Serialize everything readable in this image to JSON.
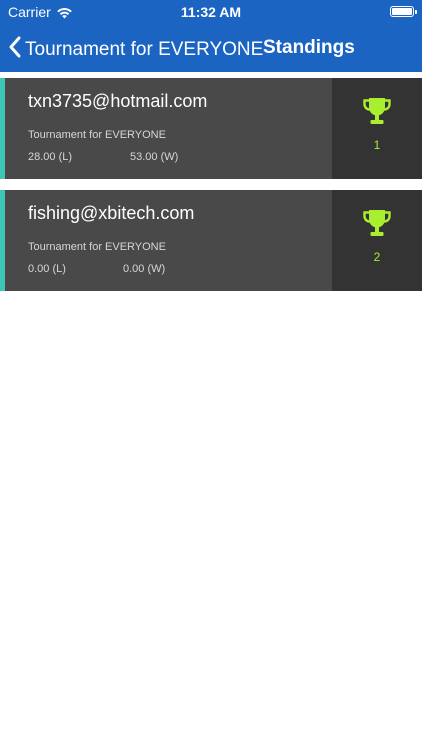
{
  "status_bar": {
    "carrier": "Carrier",
    "time": "11:32 AM"
  },
  "nav": {
    "back_label": "Tournament for EVERYONE",
    "title": "Standings"
  },
  "colors": {
    "header_bg": "#1b64c2",
    "card_bg": "#4a4949",
    "rank_bg": "#333333",
    "accent": "#3cc6b4",
    "trophy": "#a8ef2f"
  },
  "standings": [
    {
      "email": "txn3735@hotmail.com",
      "tournament": "Tournament for EVERYONE",
      "losses": "28.00 (L)",
      "wins": "53.00 (W)",
      "rank": "1",
      "icon": "trophy-icon"
    },
    {
      "email": "fishing@xbitech.com",
      "tournament": "Tournament for EVERYONE",
      "losses": "0.00 (L)",
      "wins": "0.00 (W)",
      "rank": "2",
      "icon": "trophy-icon"
    }
  ]
}
